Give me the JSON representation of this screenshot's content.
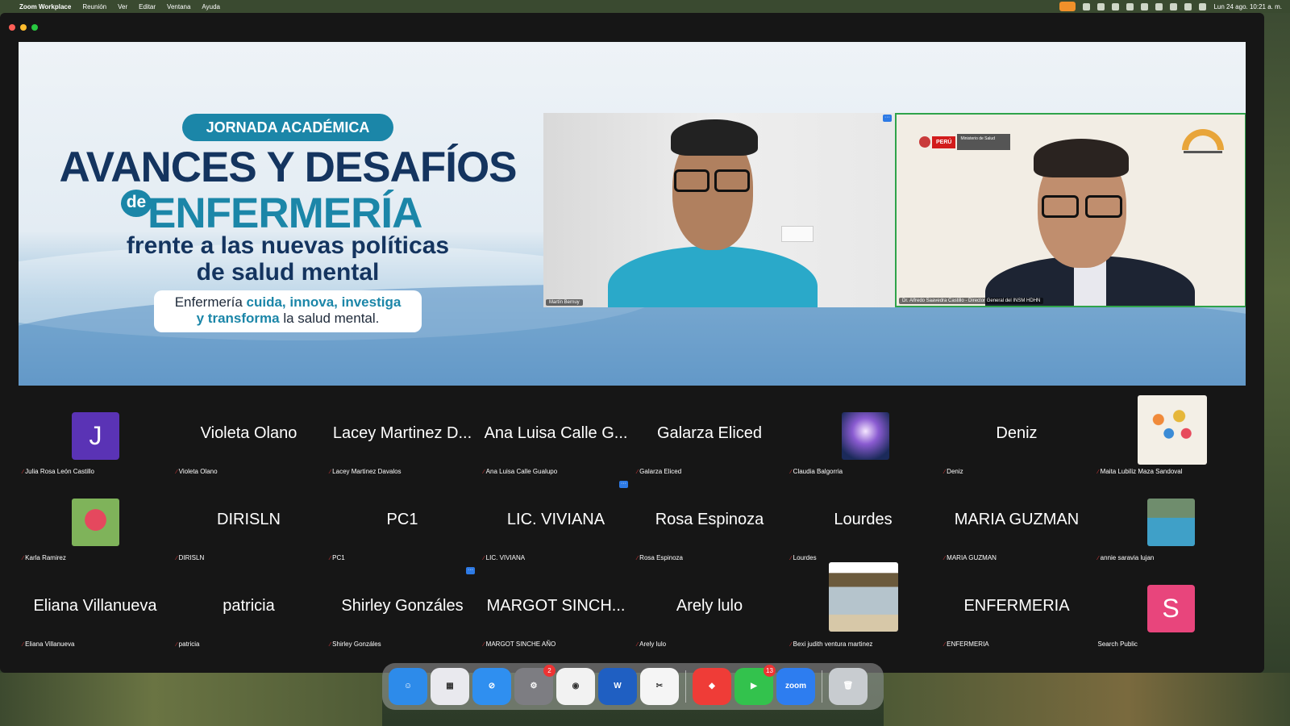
{
  "menubar": {
    "app_name": "Zoom Workplace",
    "menus": [
      "Reunión",
      "Ver",
      "Editar",
      "Ventana",
      "Ayuda"
    ],
    "datetime": "Lun 24 ago.  10:21 a. m."
  },
  "banner": {
    "pill": "JORNADA ACADÉMICA",
    "title_line1": "AVANCES Y DESAFÍOS",
    "title_de": "de",
    "title_line2": "ENFERMERÍA",
    "subtitle_line1": "frente a las nuevas políticas",
    "subtitle_line2": "de salud mental",
    "tagline_a": "Enfermería ",
    "tagline_b": "cuida, innova, investiga",
    "tagline_c": "y transforma",
    "tagline_d": " la salud mental."
  },
  "speakers": [
    {
      "name": "Martín Bernuy"
    },
    {
      "name": "Dr. Alfredo Saavedra Castillo - Director General del INSM HDHN",
      "logo_peru": "PERÚ",
      "logo_ministerio": "Ministerio de Salud"
    }
  ],
  "gallery": [
    {
      "display": "",
      "avatar": "J",
      "avatar_color": "#5a33b5",
      "label": "Julia Rosa León Castillo"
    },
    {
      "display": "Violeta Olano",
      "label": "Violeta Olano"
    },
    {
      "display": "Lacey Martinez D...",
      "label": "Lacey Martinez Davalos"
    },
    {
      "display": "Ana Luisa Calle G...",
      "label": "Ana Luisa Calle Gualupo"
    },
    {
      "display": "Galarza Eliced",
      "label": "Galarza Eliced"
    },
    {
      "display": "",
      "photo": "meditation",
      "label": "Claudia Balgorria"
    },
    {
      "display": "Deniz",
      "label": "Deniz"
    },
    {
      "display": "",
      "photo": "flowers-vase",
      "label": "Maita Lubiliz Maza Sandoval"
    },
    {
      "display": "",
      "photo": "red-flower",
      "label": "Karla Ramirez"
    },
    {
      "display": "DIRISLN",
      "label": "DIRISLN"
    },
    {
      "display": "PC1",
      "label": "PC1"
    },
    {
      "display": "LIC. VIVIANA",
      "label": "LIC. VIVIANA"
    },
    {
      "display": "Rosa Espinoza",
      "label": "Rosa Espinoza"
    },
    {
      "display": "Lourdes",
      "label": "Lourdes"
    },
    {
      "display": "MARIA GUZMAN",
      "label": "MARIA GUZMAN"
    },
    {
      "display": "",
      "photo": "pool",
      "label": "annie saravia lujan"
    },
    {
      "display": "Eliana Villanueva",
      "label": "Eliana Villanueva"
    },
    {
      "display": "patricia",
      "label": "patricia"
    },
    {
      "display": "Shirley Gonzáles",
      "label": "Shirley Gonzáles"
    },
    {
      "display": "MARGOT SINCH...",
      "label": "MARGOT SINCHE AÑO"
    },
    {
      "display": "Arely lulo",
      "label": "Arely lulo"
    },
    {
      "display": "",
      "photo": "beach-hut",
      "label": "Bexi judith ventura martinez"
    },
    {
      "display": "ENFERMERIA",
      "label": "ENFERMERIA"
    },
    {
      "display": "",
      "avatar": "S",
      "avatar_color": "#e8457c",
      "label": "Search Public"
    }
  ],
  "dock": [
    {
      "name": "finder",
      "color": "#2d8bea",
      "glyph": "☺"
    },
    {
      "name": "launchpad",
      "color": "#e9e9ee",
      "glyph": "▦"
    },
    {
      "name": "safari",
      "color": "#2f8ff0",
      "glyph": "⊘"
    },
    {
      "name": "system-settings",
      "color": "#7d7d82",
      "glyph": "⚙",
      "badge": "2"
    },
    {
      "name": "chrome",
      "color": "#f2f2f2",
      "glyph": "◉"
    },
    {
      "name": "word",
      "color": "#1f5fc2",
      "glyph": "W"
    },
    {
      "name": "capcut",
      "color": "#f5f5f5",
      "glyph": "✂"
    },
    {
      "name": "anydesk",
      "color": "#ef3c37",
      "glyph": "◆"
    },
    {
      "name": "facetime",
      "color": "#33c24d",
      "glyph": "▶",
      "badge": "13"
    },
    {
      "name": "zoom",
      "color": "#2d7df0",
      "glyph": "zoom"
    },
    {
      "name": "trash",
      "color": "#c8ccd0",
      "glyph": "🗑"
    }
  ]
}
